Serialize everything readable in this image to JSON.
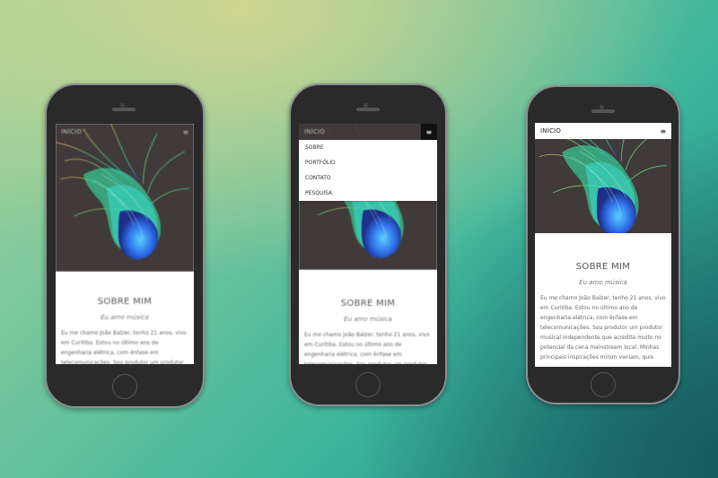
{
  "phones": [
    {
      "nav": {
        "brand": "INÍCIO",
        "menu_icon": "≡"
      },
      "section": {
        "title": "SOBRE MIM",
        "subtitle": "Eu amo música",
        "body": "Eu me chamo João Balzer, tenho 21 anos, vivo em Curitiba. Estou no último ano de engenharia elétrica, com ênfase em telecomunicações. Sou produtor um produtor"
      }
    },
    {
      "nav": {
        "brand": "INÍCIO",
        "menu_icon": "≡"
      },
      "menu": [
        "SOBRE",
        "PORTFÓLIO",
        "CONTATO",
        "PESQUISA"
      ],
      "section": {
        "title": "SOBRE MIM",
        "subtitle": "Eu amo música",
        "body": "Eu me chamo João Balzer, tenho 21 anos, vivo em Curitiba. Estou no último ano de engenharia elétrica, com ênfase em telecomunicações. Sou produtor um produtor"
      }
    },
    {
      "nav": {
        "brand": "INÍCIO",
        "menu_icon": "≡"
      },
      "section": {
        "title": "SOBRE MIM",
        "subtitle": "Eu amo música",
        "body": "Eu me chamo João Balzer, tenho 21 anos, vivo em Curitiba. Estou no último ano de engenharia elétrica, com ênfase em telecomunicações. Sou produtor um produtor musical independente que acredita muito no potencial da cena mainstream local. Minhas principais inspirações minim veniam, quis"
      }
    }
  ],
  "colors": {
    "hero_bg": "#403a3a",
    "nav_dark": "#3f3a3a",
    "accent_green": "#46e39a",
    "accent_blue": "#2a5fd8"
  }
}
